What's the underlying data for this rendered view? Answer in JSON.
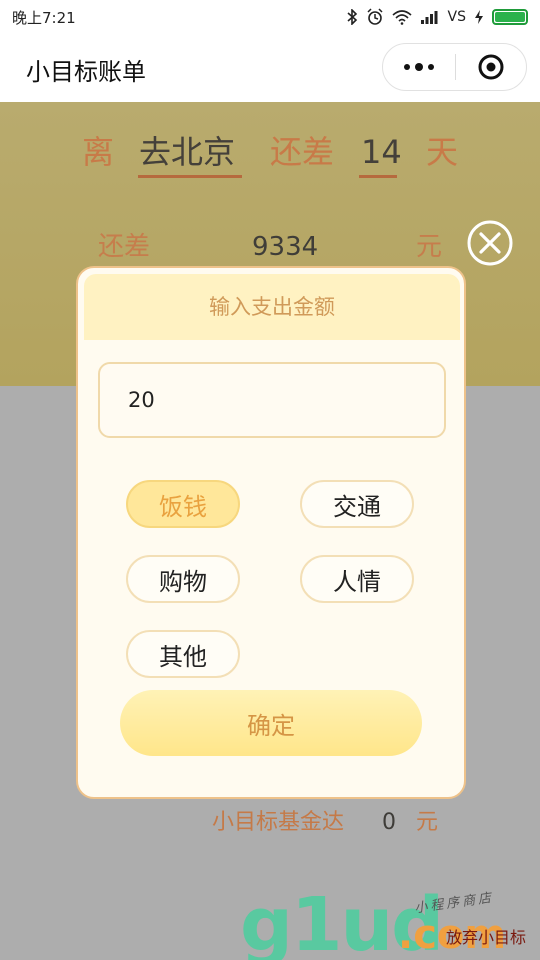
{
  "status_bar": {
    "time": "晚上7:21",
    "carrier": "VS",
    "icons": [
      "bluetooth-icon",
      "alarm-icon",
      "wifi-icon",
      "signal-icon",
      "charging-icon",
      "battery-icon"
    ]
  },
  "nav": {
    "title": "小目标账单"
  },
  "goal": {
    "prefix": "离",
    "destination": "去北京",
    "middle": "还差",
    "days": "14",
    "suffix": "天"
  },
  "remaining": {
    "label": "还差",
    "amount": "9334",
    "unit": "元"
  },
  "dialog": {
    "title": "输入支出金额",
    "amount_value": "20",
    "categories": [
      {
        "label": "饭钱",
        "selected": true
      },
      {
        "label": "交通",
        "selected": false
      },
      {
        "label": "购物",
        "selected": false
      },
      {
        "label": "人情",
        "selected": false
      },
      {
        "label": "其他",
        "selected": false
      }
    ],
    "confirm_label": "确定"
  },
  "fund": {
    "label": "小目标基金达",
    "amount": "0",
    "unit": "元"
  },
  "watermark": {
    "logo": "g1ud",
    "domain": ".com",
    "slogan": "小程序商店",
    "text": "放弃小目标"
  },
  "colors": {
    "header_band": "#b5a663",
    "accent_text": "#c87a48",
    "dialog_border": "#eec28a",
    "selected_category": "#ffe79a",
    "overlay": "#adadad"
  }
}
